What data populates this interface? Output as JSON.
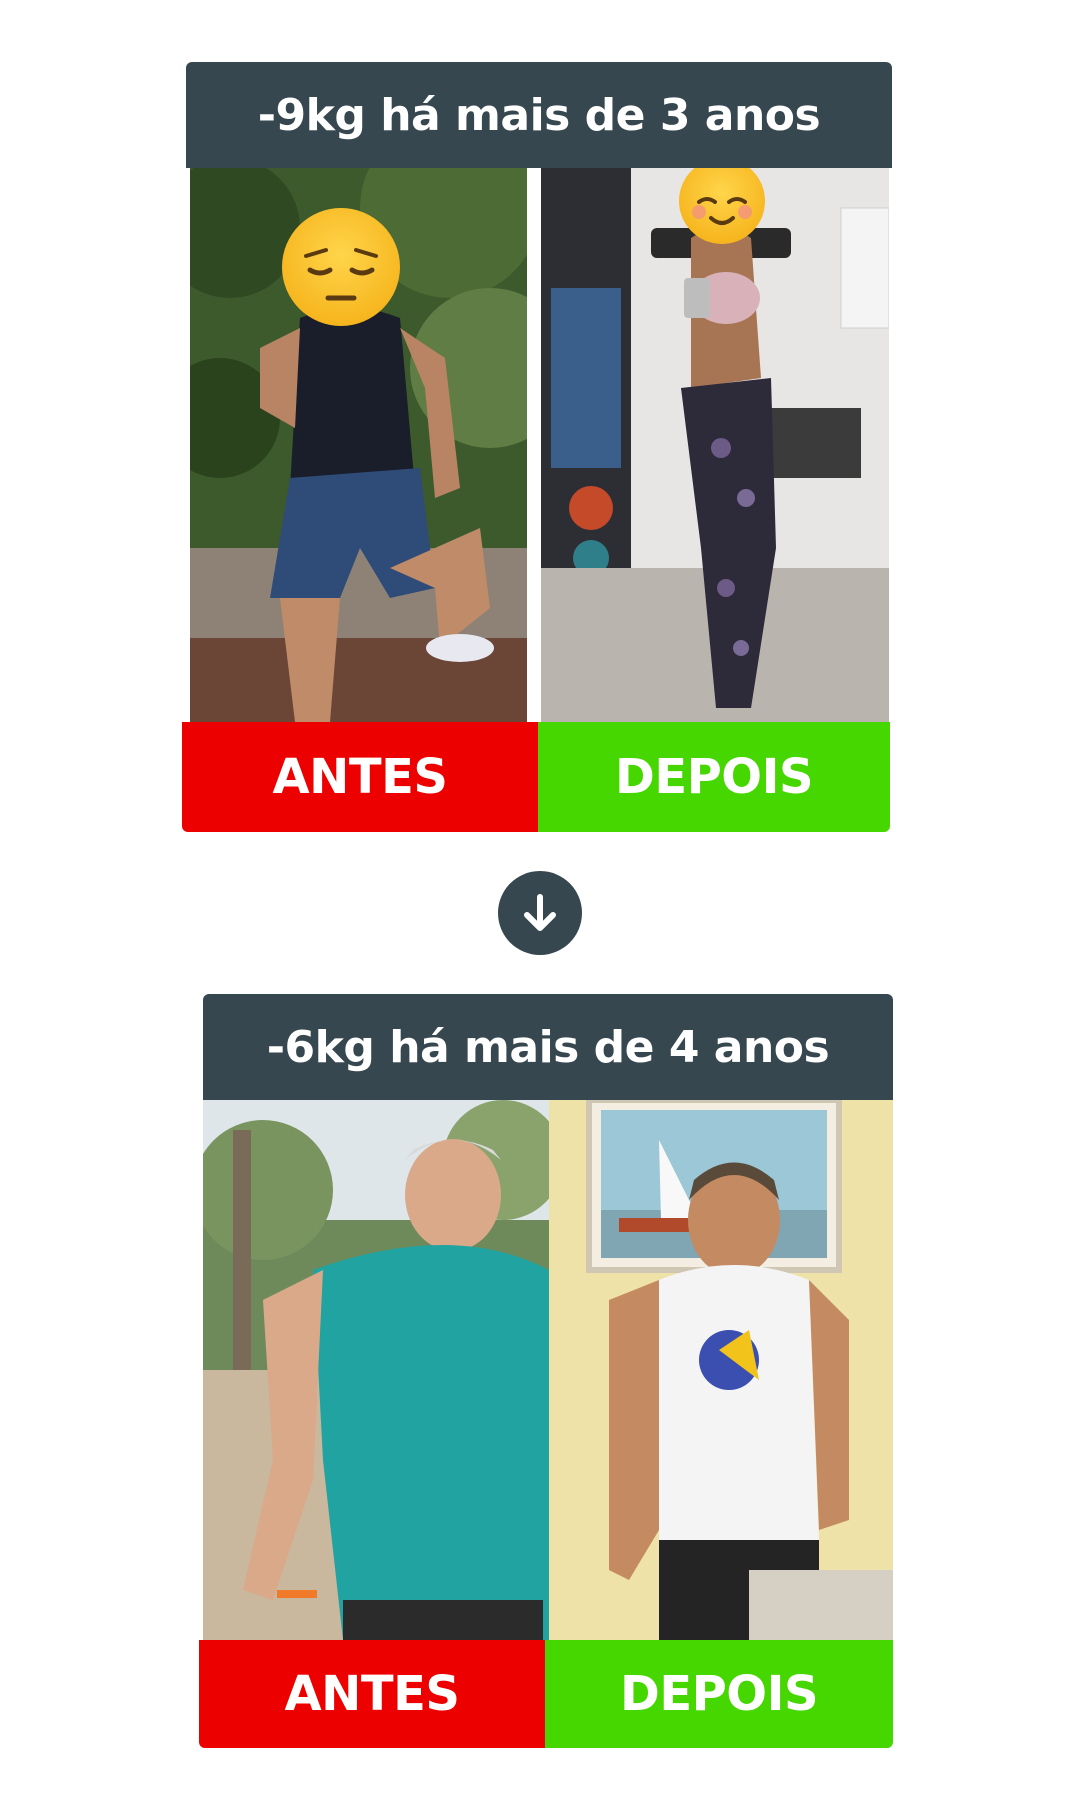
{
  "cards": [
    {
      "title": "-9kg há mais de 3 anos",
      "before_label": "ANTES",
      "after_label": "DEPOIS",
      "before_photo": "woman-before-photo",
      "after_photo": "woman-after-photo"
    },
    {
      "title": "-6kg há mais de 4 anos",
      "before_label": "ANTES",
      "after_label": "DEPOIS",
      "before_photo": "man-before-photo",
      "after_photo": "man-after-photo"
    }
  ],
  "divider": {
    "icon": "arrow-down-icon"
  },
  "colors": {
    "title_bg": "#37474f",
    "before_bg": "#ec0000",
    "after_bg": "#46d600",
    "text": "#ffffff"
  }
}
